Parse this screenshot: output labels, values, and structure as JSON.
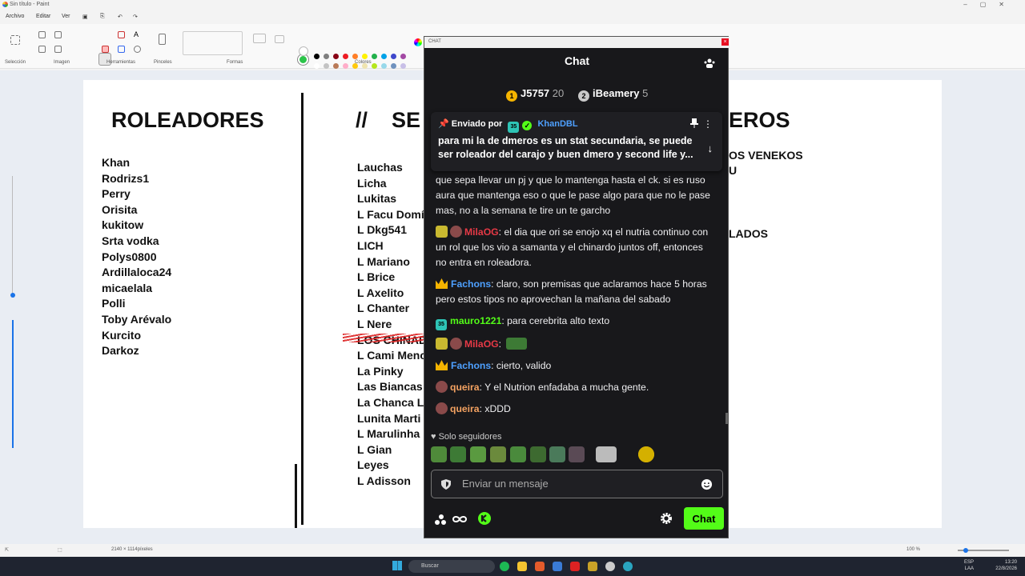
{
  "window": {
    "title": "Sin título - Paint"
  },
  "menu": [
    "Archivo",
    "Editar",
    "Ver"
  ],
  "ribbon_groups": [
    "Selección",
    "Imagen",
    "Herramientas",
    "Pinceles",
    "Formas",
    "Colores"
  ],
  "palette": [
    "#000000",
    "#7f7f7f",
    "#880015",
    "#ed1c24",
    "#ff7f27",
    "#fff200",
    "#22b14c",
    "#00a2e8",
    "#3f48cc",
    "#a349a4",
    "#ffffff",
    "#c3c3c3",
    "#b97a57",
    "#ffaec9",
    "#ffc90e",
    "#efe4b0",
    "#b5e61d",
    "#99d9ea",
    "#7092be",
    "#c8bfe7"
  ],
  "canvas": {
    "heading_left": "ROLEADORES",
    "heading_mid": "//    SE",
    "heading_right": "EROS",
    "left_list": [
      "Khan",
      "Rodrizs1",
      "Perry",
      "Orisita",
      "kukitow",
      "Srta vodka",
      "Polys0800",
      "Ardillaloca24",
      "micaelala",
      "Polli",
      "Toby Arévalo",
      "Kurcito",
      "Darkoz"
    ],
    "mid_list": [
      "Lauchas",
      "Licha",
      "Lukitas",
      "L Facu Domín",
      "L Dkg541",
      "LICH",
      "L Mariano",
      "L Brice",
      "L Axelito",
      "L Chanter",
      "L Nere",
      "LOS CHINAD",
      "L Cami Menc",
      "La Pinky",
      "Las Biancas",
      "La Chanca Le",
      "Lunita Marti",
      "L Marulinha",
      "L Gian",
      "Leyes",
      "L Adisson"
    ],
    "right_partial_1": "OS VENEKOS",
    "right_partial_2": "U",
    "right_partial_3": "LADOS"
  },
  "status": {
    "dimensions": "2140 × 1114píxeles",
    "zoom": "100 %"
  },
  "taskbar": {
    "search_placeholder": "Buscar",
    "lang": "ESP",
    "lang2": "LAA",
    "time": "13:20",
    "date": "22/8/2026"
  },
  "chat": {
    "frame_title": "CHAT",
    "title": "Chat",
    "leaders": [
      {
        "rank": "1",
        "name": "J5757",
        "points": "20",
        "color": "#f5b400"
      },
      {
        "rank": "2",
        "name": "iBeamery",
        "points": "5",
        "color": "#c9c9c9"
      }
    ],
    "pinned": {
      "label": "Enviado por",
      "user": "KhanDBL",
      "sub_months": "35",
      "text": "para mi la de dmeros es un stat secundaria, se puede ser roleador del carajo y buen dmero y second life y..."
    },
    "messages": [
      {
        "user": "",
        "color": "#efeff1",
        "text": "que sepa llevar un pj y que lo mantenga hasta el ck. si es ruso aura que mantenga eso o que le pase algo para que no le pase mas, no a la semana te tire un te garcho",
        "badges": []
      },
      {
        "user": "MilaOG",
        "color": "#e63946",
        "text": ": el dia que ori se enojo xq el nutria continuo con un rol que los vio a samanta y el chinardo juntos off, entonces no entra en roleadora.",
        "badges": [
          "emote",
          "avatar"
        ]
      },
      {
        "user": "Fachons",
        "color": "#4ea0ff",
        "text": ": claro, son premisas que aclaramos hace 5 horas pero estos tipos no aprovechan la mañana del sabado",
        "badges": [
          "crown"
        ]
      },
      {
        "user": "mauro1221",
        "color": "#53fc18",
        "text": ": para cerebrita alto texto",
        "badges": [
          "sub"
        ]
      },
      {
        "user": "MilaOG",
        "color": "#e63946",
        "text": ":",
        "badges": [
          "emote",
          "avatar",
          "pepe"
        ]
      },
      {
        "user": "Fachons",
        "color": "#4ea0ff",
        "text": ": cierto, valido",
        "badges": [
          "crown"
        ]
      },
      {
        "user": "queira",
        "color": "#f4a261",
        "text": ": Y el Nutrion enfadaba a mucha gente.",
        "badges": [
          "avatar"
        ]
      },
      {
        "user": "queira",
        "color": "#f4a261",
        "text": ": xDDD",
        "badges": [
          "avatar"
        ]
      }
    ],
    "followers_only": "Solo seguidores",
    "input_placeholder": "Enviar un mensaje",
    "send_label": "Chat",
    "accent": "#53fc18"
  }
}
